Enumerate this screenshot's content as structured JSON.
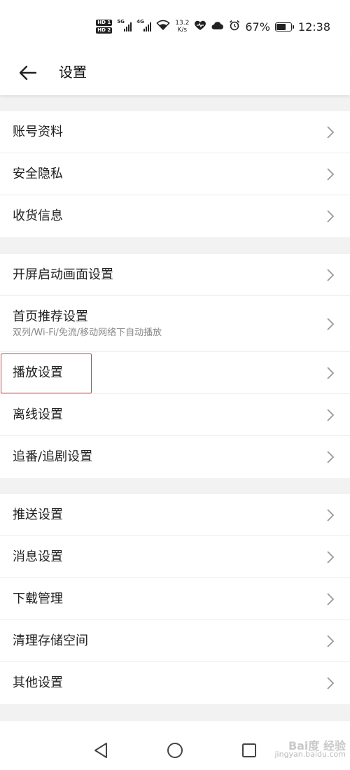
{
  "status_bar": {
    "hd1": "HD 1",
    "hd2": "HD 2",
    "signal1_gen": "5G",
    "signal2_gen": "4G",
    "speed_value": "13.2",
    "speed_unit": "K/s",
    "battery_percent": "67%",
    "battery_level": 0.67,
    "time": "12:38",
    "icons": [
      "wifi-icon",
      "heart-icon",
      "cloud-icon",
      "alarm-icon"
    ]
  },
  "header": {
    "back_icon": "arrow-left-icon",
    "title": "设置"
  },
  "groups": [
    {
      "items": [
        {
          "label": "账号资料"
        },
        {
          "label": "安全隐私"
        },
        {
          "label": "收货信息"
        }
      ]
    },
    {
      "items": [
        {
          "label": "开屏启动画面设置"
        },
        {
          "label": "首页推荐设置",
          "subtitle": "双列/Wi-Fi/免流/移动网络下自动播放"
        },
        {
          "label": "播放设置",
          "highlighted": true
        },
        {
          "label": "离线设置"
        },
        {
          "label": "追番/追剧设置"
        }
      ]
    },
    {
      "items": [
        {
          "label": "推送设置"
        },
        {
          "label": "消息设置"
        },
        {
          "label": "下载管理"
        },
        {
          "label": "清理存储空间"
        },
        {
          "label": "其他设置"
        }
      ]
    }
  ],
  "nav_bar": {
    "icons": [
      "nav-back-icon",
      "nav-home-icon",
      "nav-recents-icon"
    ]
  },
  "watermark": {
    "brand": "Bai度 经验",
    "domain": "jingyan.baidu.com"
  },
  "colors": {
    "highlight_border": "#e23b3b",
    "divider": "#ececec",
    "background": "#f2f2f2"
  }
}
